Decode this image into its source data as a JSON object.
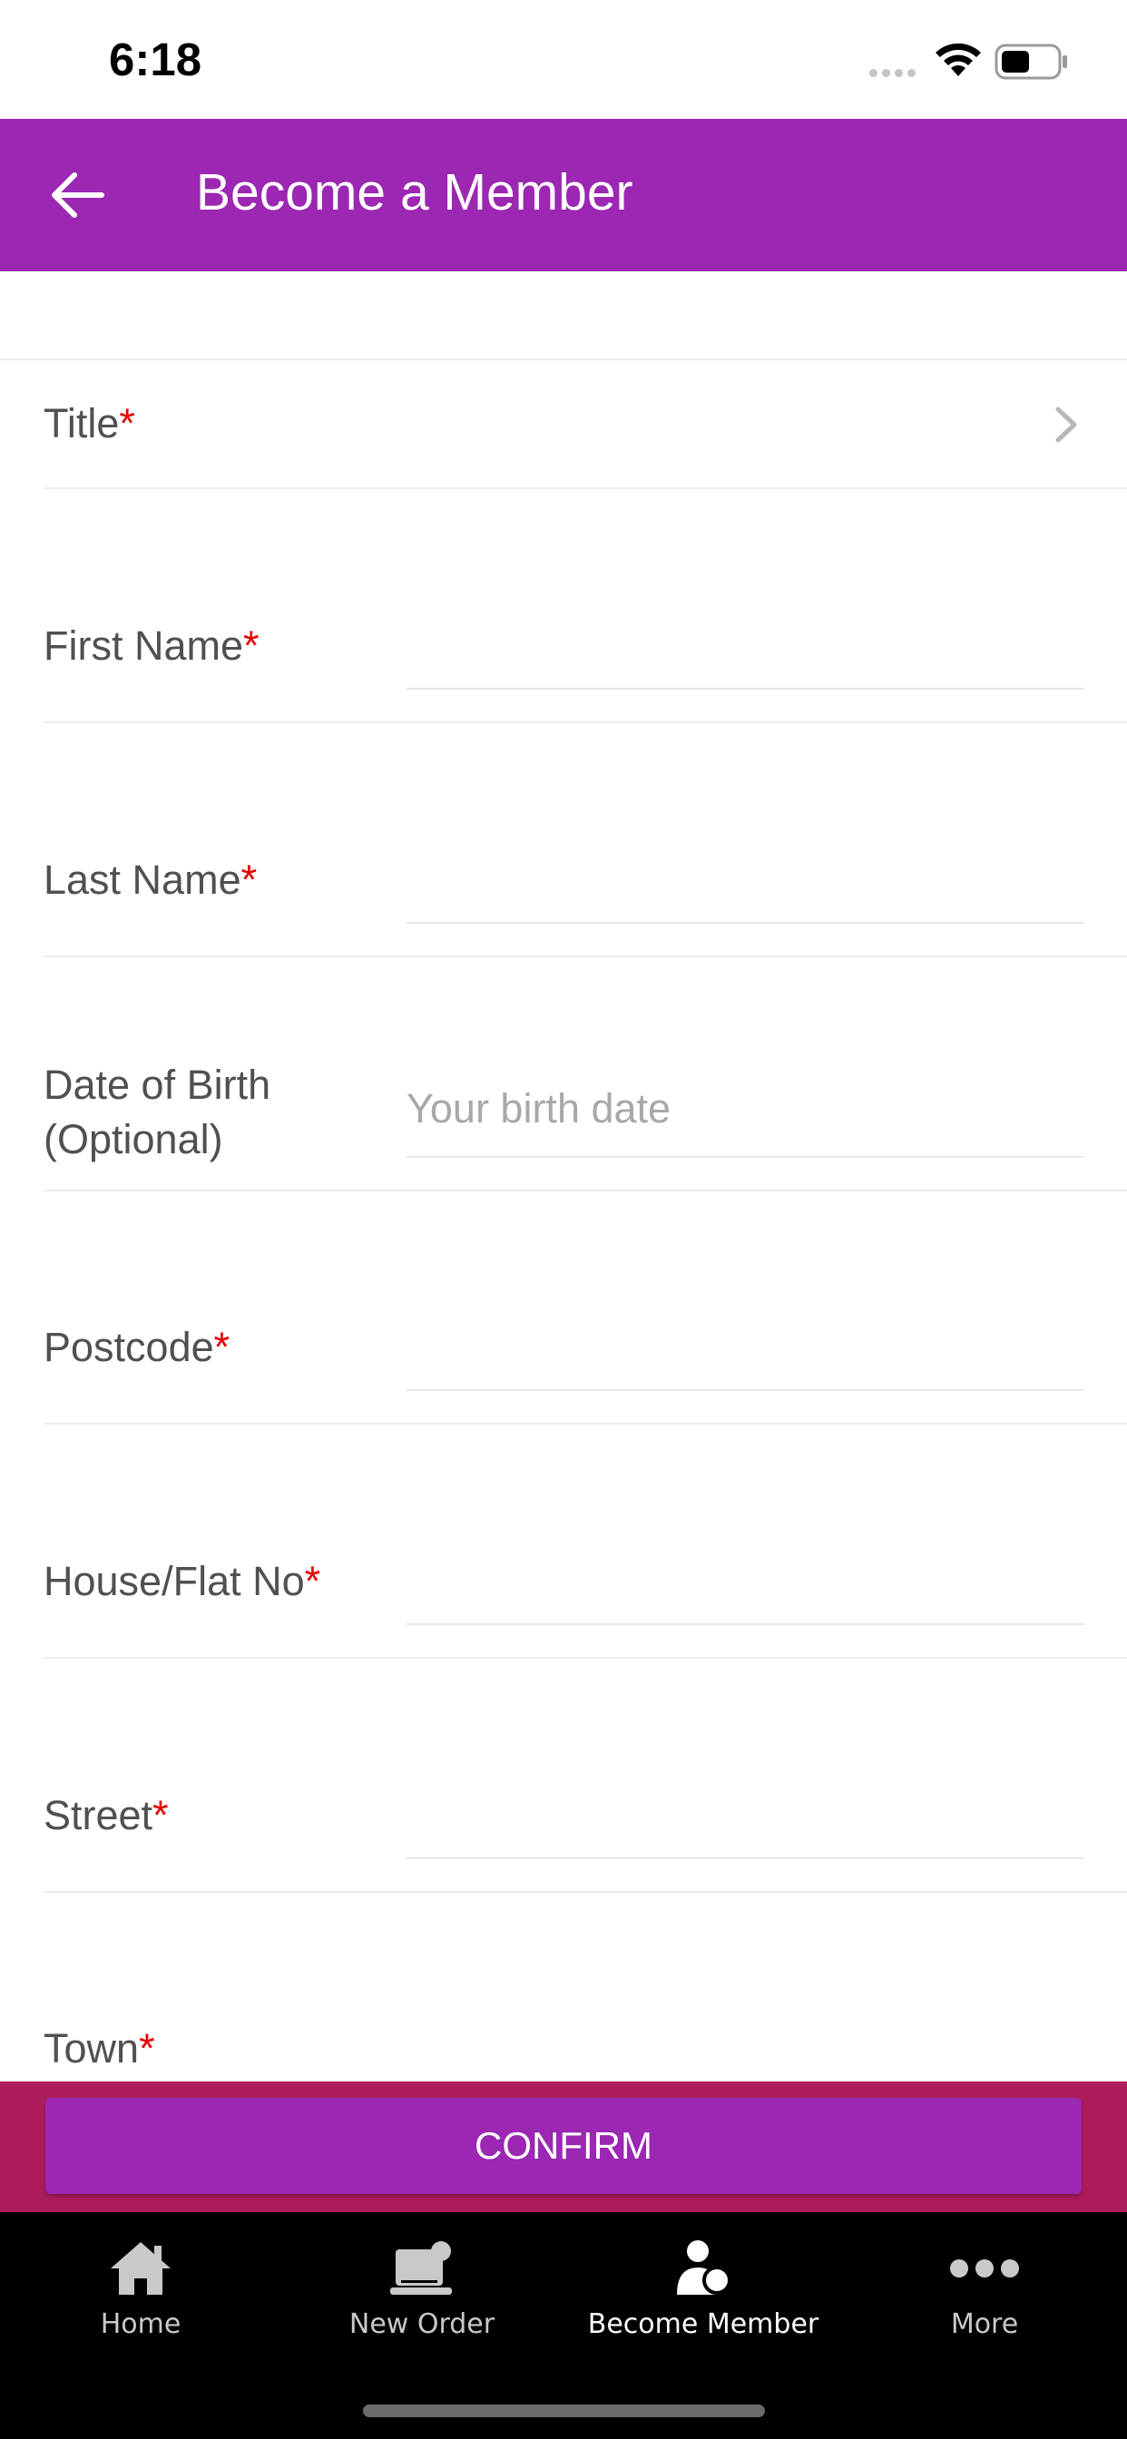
{
  "status_bar": {
    "time": "6:18"
  },
  "header": {
    "title": "Become a Member"
  },
  "form": {
    "required_marker": "*",
    "fields": [
      {
        "label": "Title"
      },
      {
        "label": "First Name",
        "value": ""
      },
      {
        "label": "Last Name",
        "value": ""
      },
      {
        "label_line1": "Date of Birth",
        "label_line2": "(Optional)",
        "placeholder": "Your birth date",
        "value": ""
      },
      {
        "label": "Postcode",
        "value": ""
      },
      {
        "label": "House/Flat No",
        "value": ""
      },
      {
        "label": "Street",
        "value": ""
      },
      {
        "label": "Town"
      }
    ]
  },
  "confirm": {
    "label": "CONFIRM"
  },
  "tabs": [
    {
      "label": "Home",
      "icon": "home-icon"
    },
    {
      "label": "New Order",
      "icon": "new-order-icon"
    },
    {
      "label": "Become Member",
      "icon": "member-icon",
      "active": true
    },
    {
      "label": "More",
      "icon": "more-icon"
    }
  ],
  "colors": {
    "primary": "#9b27b3",
    "confirm_bar": "#ad1d5c",
    "required": "#e60000",
    "tab_bar": "#000000"
  }
}
